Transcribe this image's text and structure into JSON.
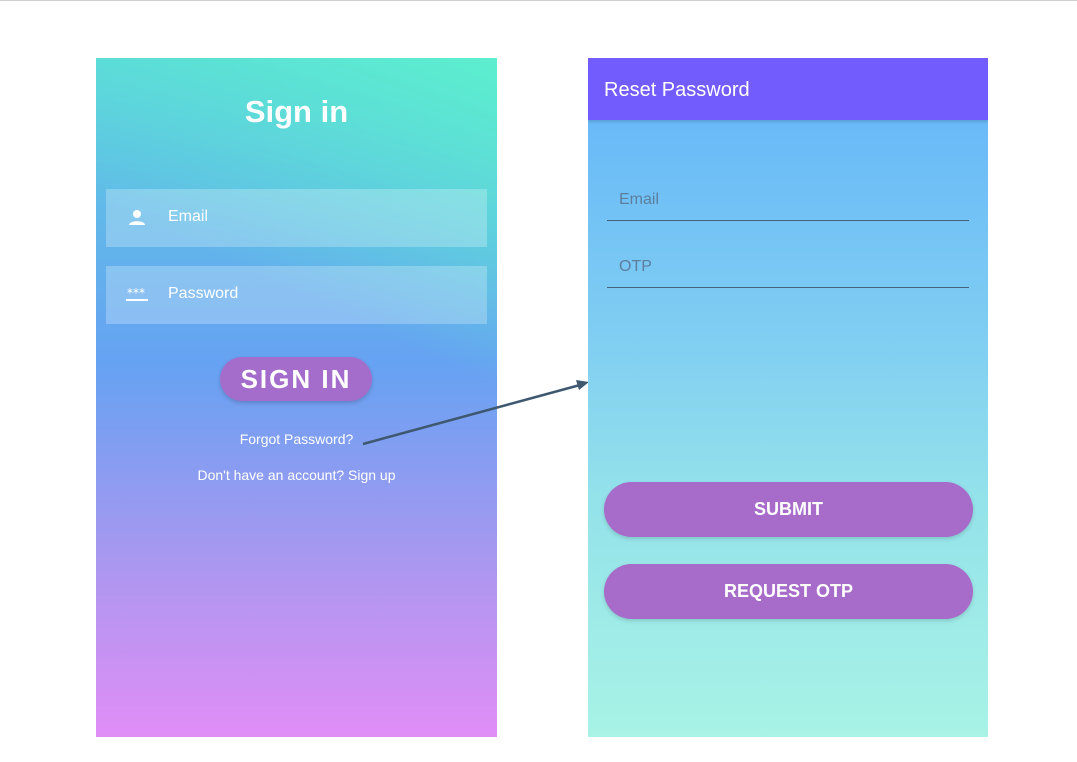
{
  "signin_screen": {
    "title": "Sign in",
    "email": {
      "placeholder": "Email",
      "icon": "person-icon"
    },
    "password": {
      "placeholder": "Password",
      "icon": "password-dots-icon"
    },
    "signin_button": "SIGN IN",
    "forgot_password": "Forgot Password?",
    "signup_prompt": "Don't have an account? Sign up"
  },
  "reset_screen": {
    "title": "Reset Password",
    "email": {
      "placeholder": "Email"
    },
    "otp": {
      "placeholder": "OTP"
    },
    "submit_button": "SUBMIT",
    "request_otp_button": "REQUEST OTP"
  },
  "colors": {
    "appbar": "#735cfe",
    "button": "#a76bc9",
    "arrow": "#3e5870"
  }
}
